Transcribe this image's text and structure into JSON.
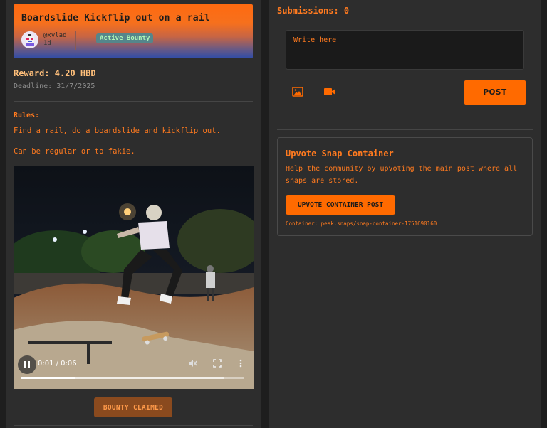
{
  "bounty": {
    "title": "Boardslide Kickflip out on a rail",
    "author": "@xvlad",
    "age": "1d",
    "status": "Active Bounty",
    "reward": "Reward: 4.20 HBD",
    "deadline": "Deadline: 31/7/2025",
    "rules_label": "Rules:",
    "rules": [
      "Find a rail, do a boardslide and kickflip out.",
      "Can be regular or to fakie."
    ],
    "video": {
      "time": "0:01 / 0:06",
      "progress_fraction": 0.24,
      "buffered_fraction": 0.91,
      "icons": [
        "pause-icon",
        "mute-icon",
        "fullscreen-icon",
        "more-options-icon"
      ]
    },
    "claimed_label": "BOUNTY CLAIMED"
  },
  "submission": {
    "count_label": "Submissions: 0",
    "placeholder": "Write here",
    "icons": [
      "image-icon",
      "video-icon"
    ],
    "post_label": "POST"
  },
  "upvote": {
    "title": "Upvote Snap Container",
    "description": "Help the community by upvoting the main post where all snaps are stored.",
    "button_label": "UPVOTE CONTAINER POST",
    "container_ref": "Container: peak.snaps/snap-container-1751690160"
  },
  "colors": {
    "accent": "#ff6a00",
    "text_orange": "#ff7a1f",
    "panel": "#2d2d2d",
    "background": "#1e1e1e",
    "reward": "#ffbf7a",
    "claimed_bg": "#8a4a1e"
  }
}
